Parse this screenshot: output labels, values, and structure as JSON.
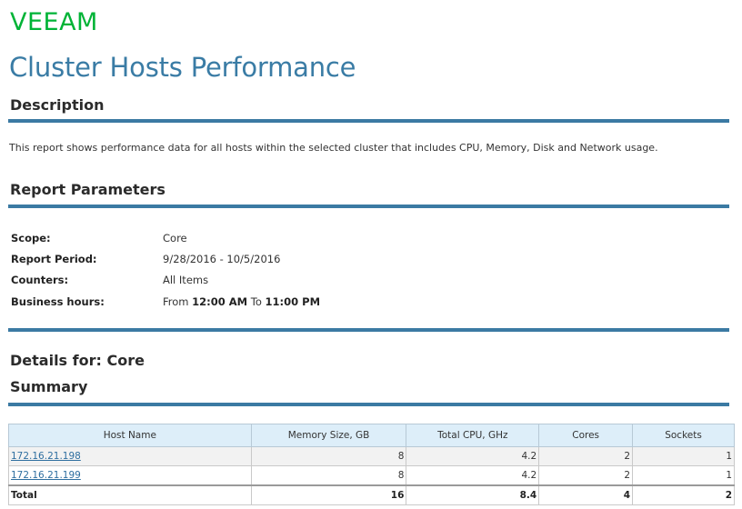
{
  "logo": {
    "text": "VEEAM",
    "color": "#00b336"
  },
  "report": {
    "title": "Cluster Hosts Performance",
    "description_heading": "Description",
    "description_text": "This report shows performance data for all hosts within the selected cluster that includes CPU, Memory, Disk and Network usage.",
    "parameters_heading": "Report Parameters",
    "parameters": {
      "scope_label": "Scope:",
      "scope_value": "Core",
      "period_label": "Report Period:",
      "period_value": "9/28/2016 - 10/5/2016",
      "counters_label": "Counters:",
      "counters_value": "All Items",
      "hours_label": "Business hours:",
      "hours_from": "From",
      "hours_start": "12:00 AM",
      "hours_to": "To",
      "hours_end": "11:00 PM"
    },
    "details_heading": "Details for: Core",
    "summary_heading": "Summary"
  },
  "table": {
    "headers": [
      "Host Name",
      "Memory Size, GB",
      "Total CPU, GHz",
      "Cores",
      "Sockets"
    ],
    "rows": [
      {
        "host": "172.16.21.198",
        "memory": "8",
        "cpu": "4.2",
        "cores": "2",
        "sockets": "1"
      },
      {
        "host": "172.16.21.199",
        "memory": "8",
        "cpu": "4.2",
        "cores": "2",
        "sockets": "1"
      }
    ],
    "total": {
      "label": "Total",
      "memory": "16",
      "cpu": "8.4",
      "cores": "4",
      "sockets": "2"
    }
  },
  "colors": {
    "accent": "#3b7aa3",
    "title": "#3a7ca5",
    "header_bg": "#ddeef9",
    "link": "#2f6fa0"
  }
}
